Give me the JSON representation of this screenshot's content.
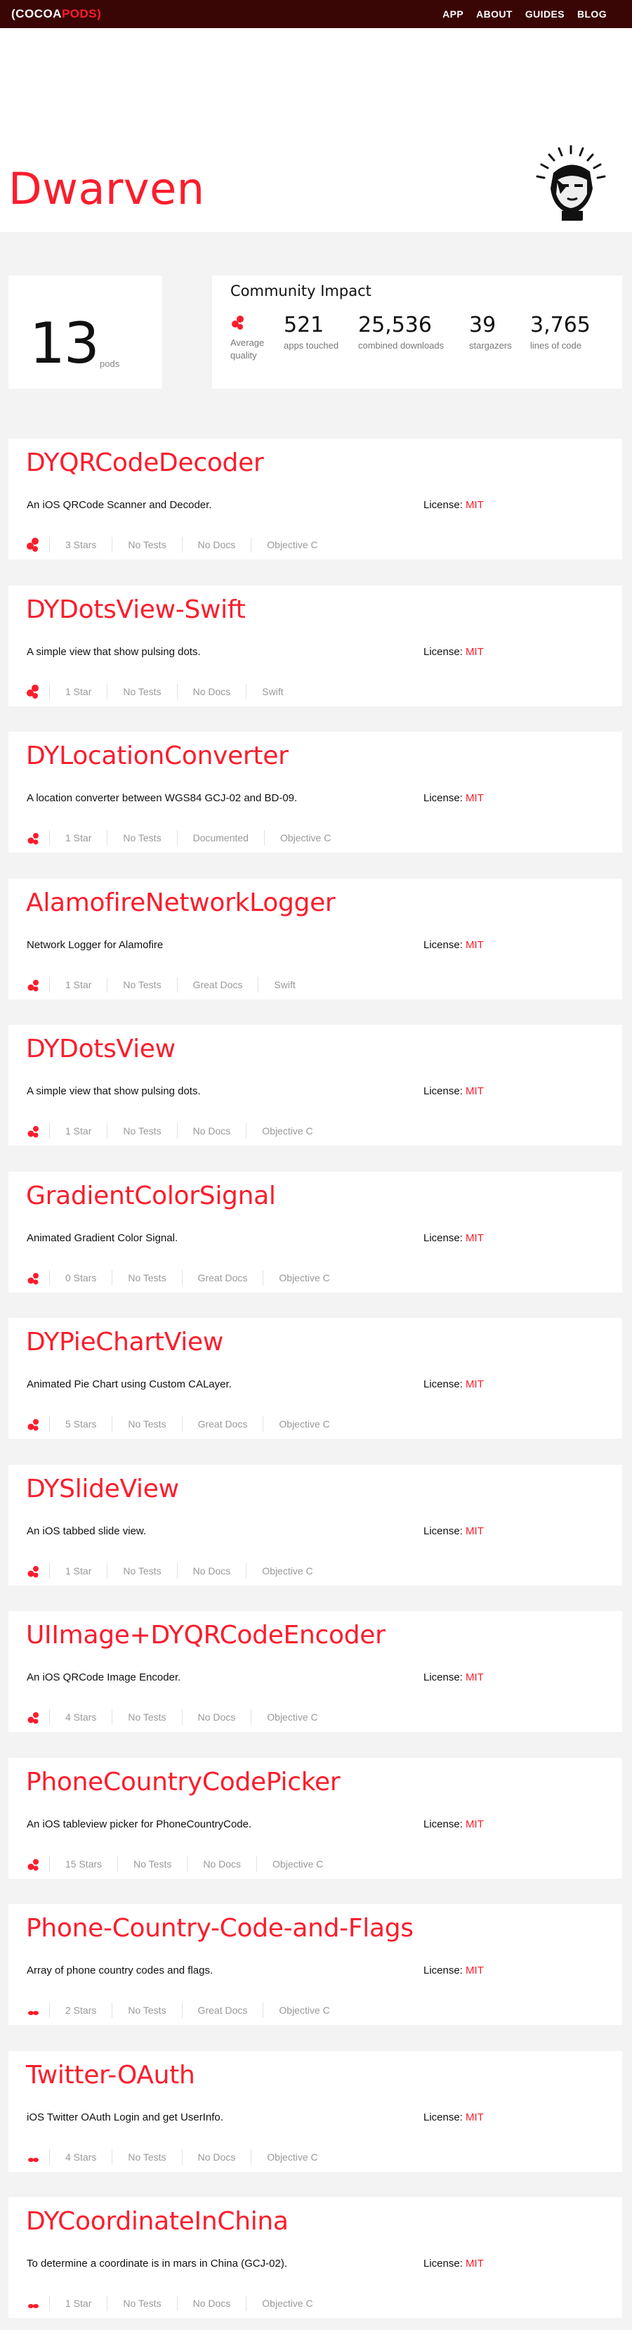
{
  "nav": {
    "logo_cocoa": "(COCOA",
    "logo_pods": "PODS)",
    "links": [
      "APP",
      "ABOUT",
      "GUIDES",
      "BLOG"
    ]
  },
  "profile": {
    "name": "Dwarven"
  },
  "stats": {
    "pods_count": "13",
    "pods_label": "pods",
    "impact_title": "Community Impact",
    "quality_label": "Average quality",
    "apps_touched": "521",
    "apps_touched_label": "apps touched",
    "downloads": "25,536",
    "downloads_label": "combined downloads",
    "stargazers": "39",
    "stargazers_label": "stargazers",
    "lines": "3,765",
    "lines_label": "lines of code"
  },
  "license_label": "License:",
  "pods": [
    {
      "name": "DYQRCodeDecoder",
      "desc": "An iOS QRCode Scanner and Decoder.",
      "license": "MIT",
      "stars": "3 Stars",
      "tests": "No Tests",
      "docs": "No Docs",
      "lang": "Objective C",
      "quality": "high"
    },
    {
      "name": "DYDotsView-Swift",
      "desc": "A simple view that show pulsing dots.",
      "license": "MIT",
      "stars": "1 Star",
      "tests": "No Tests",
      "docs": "No Docs",
      "lang": "Swift",
      "quality": "high"
    },
    {
      "name": "DYLocationConverter",
      "desc": "A location converter between WGS84 GCJ-02 and BD-09.",
      "license": "MIT",
      "stars": "1 Star",
      "tests": "No Tests",
      "docs": "Documented",
      "lang": "Objective C",
      "quality": "mid"
    },
    {
      "name": "AlamofireNetworkLogger",
      "desc": "Network Logger for Alamofire",
      "license": "MIT",
      "stars": "1 Star",
      "tests": "No Tests",
      "docs": "Great Docs",
      "lang": "Swift",
      "quality": "mid"
    },
    {
      "name": "DYDotsView",
      "desc": "A simple view that show pulsing dots.",
      "license": "MIT",
      "stars": "1 Star",
      "tests": "No Tests",
      "docs": "No Docs",
      "lang": "Objective C",
      "quality": "mid"
    },
    {
      "name": "GradientColorSignal",
      "desc": "Animated Gradient Color Signal.",
      "license": "MIT",
      "stars": "0 Stars",
      "tests": "No Tests",
      "docs": "Great Docs",
      "lang": "Objective C",
      "quality": "mid"
    },
    {
      "name": "DYPieChartView",
      "desc": "Animated Pie Chart using Custom CALayer.",
      "license": "MIT",
      "stars": "5 Stars",
      "tests": "No Tests",
      "docs": "Great Docs",
      "lang": "Objective C",
      "quality": "mid"
    },
    {
      "name": "DYSlideView",
      "desc": "An iOS tabbed slide view.",
      "license": "MIT",
      "stars": "1 Star",
      "tests": "No Tests",
      "docs": "No Docs",
      "lang": "Objective C",
      "quality": "mid"
    },
    {
      "name": "UIImage+DYQRCodeEncoder",
      "desc": "An iOS QRCode Image Encoder.",
      "license": "MIT",
      "stars": "4 Stars",
      "tests": "No Tests",
      "docs": "No Docs",
      "lang": "Objective C",
      "quality": "mid"
    },
    {
      "name": "PhoneCountryCodePicker",
      "desc": "An iOS tableview picker for PhoneCountryCode.",
      "license": "MIT",
      "stars": "15 Stars",
      "tests": "No Tests",
      "docs": "No Docs",
      "lang": "Objective C",
      "quality": "mid"
    },
    {
      "name": "Phone-Country-Code-and-Flags",
      "desc": "Array of phone country codes and flags.",
      "license": "MIT",
      "stars": "2 Stars",
      "tests": "No Tests",
      "docs": "Great Docs",
      "lang": "Objective C",
      "quality": "low"
    },
    {
      "name": "Twitter-OAuth",
      "desc": "iOS Twitter OAuth Login and get UserInfo.",
      "license": "MIT",
      "stars": "4 Stars",
      "tests": "No Tests",
      "docs": "No Docs",
      "lang": "Objective C",
      "quality": "low"
    },
    {
      "name": "DYCoordinateInChina",
      "desc": "To determine a coordinate is in mars in China (GCJ-02).",
      "license": "MIT",
      "stars": "1 Star",
      "tests": "No Tests",
      "docs": "No Docs",
      "lang": "Objective C",
      "quality": "low"
    }
  ],
  "colors": {
    "nav_bg": "#3a0505",
    "accent": "#fb1d2c",
    "page_bg": "#f3f3f3"
  }
}
